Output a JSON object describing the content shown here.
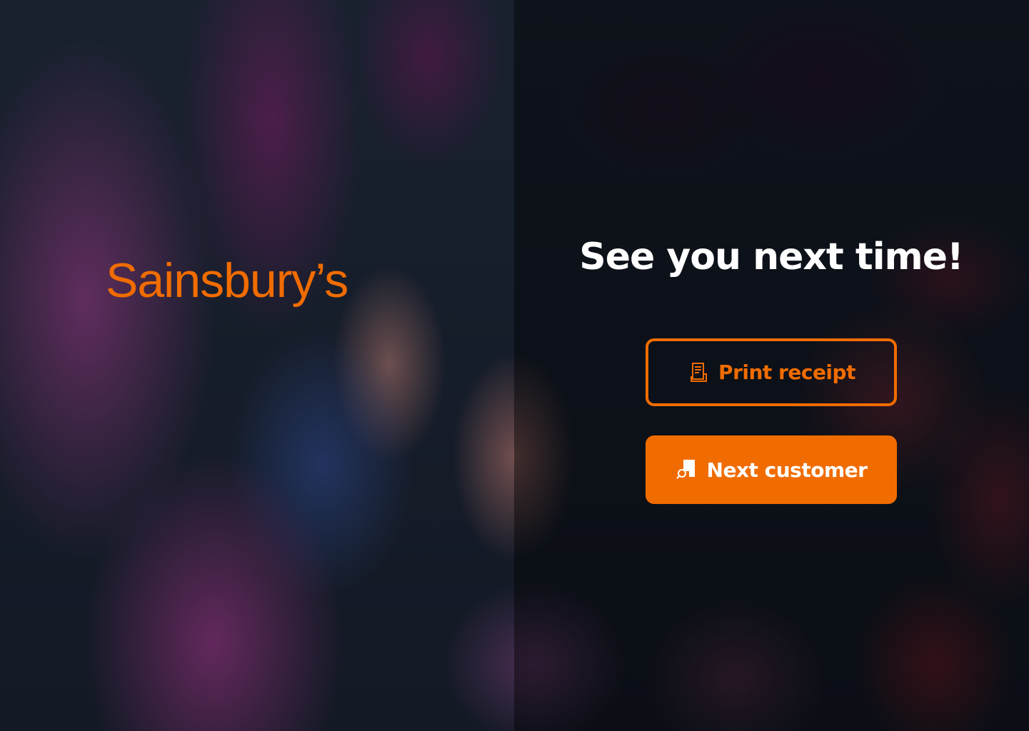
{
  "brand": {
    "logo_text": "Sainsbury’s",
    "color": "#f06c00"
  },
  "screen": {
    "headline": "See you next time!"
  },
  "actions": {
    "print_receipt": {
      "label": "Print receipt",
      "icon": "receipt-icon"
    },
    "next_customer": {
      "label": "Next customer",
      "icon": "shopping-grid-icon"
    }
  },
  "theme": {
    "accent": "#f06c00",
    "text": "#ffffff"
  }
}
